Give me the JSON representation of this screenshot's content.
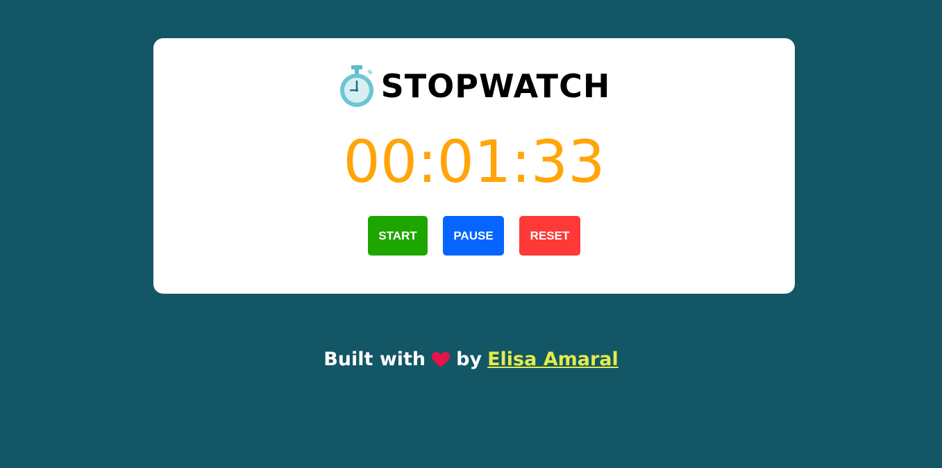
{
  "app": {
    "title": "STOPWATCH",
    "title_icon": "stopwatch-icon"
  },
  "timer": {
    "display": "00:01:33"
  },
  "controls": {
    "start_label": "START",
    "pause_label": "PAUSE",
    "reset_label": "RESET"
  },
  "footer": {
    "prefix": "Built with",
    "icon": "heart-icon",
    "by": "by",
    "author": "Elisa Amaral"
  },
  "colors": {
    "background": "#135666",
    "card": "#ffffff",
    "time": "#ffa50a",
    "start": "#1ea600",
    "pause": "#0665ff",
    "reset": "#ff3838",
    "author_link": "#e4ec4c",
    "heart": "#e8124a"
  }
}
